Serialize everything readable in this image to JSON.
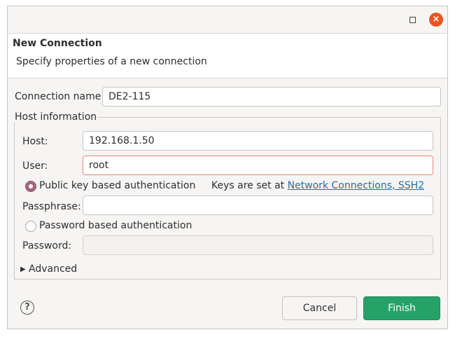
{
  "header": {
    "title": "New Connection",
    "subtitle": "Specify properties of a new connection"
  },
  "connection": {
    "label": "Connection name:",
    "value": "DE2-115"
  },
  "host_group": {
    "legend": "Host information",
    "host_label": "Host:",
    "host_value": "192.168.1.50",
    "user_label": "User:",
    "user_value": "root",
    "pubkey_label": "Public key based authentication",
    "keys_text": "Keys are set at",
    "keys_link": "Network Connections, SSH2",
    "passphrase_label": "Passphrase:",
    "passphrase_value": "",
    "password_auth_label": "Password based authentication",
    "password_label": "Password:",
    "password_value": ""
  },
  "advanced": {
    "label": "Advanced"
  },
  "buttons": {
    "cancel": "Cancel",
    "finish": "Finish"
  },
  "icons": {
    "maximize": "maximize-icon",
    "close": "close-icon",
    "help": "help-icon",
    "expand": "chevron-right-icon"
  },
  "colors": {
    "accent_close": "#e95420",
    "finish_green": "#26a269",
    "radio_selected": "#a6657f",
    "focus_border": "#e9866b",
    "link": "#1a6fb3"
  }
}
